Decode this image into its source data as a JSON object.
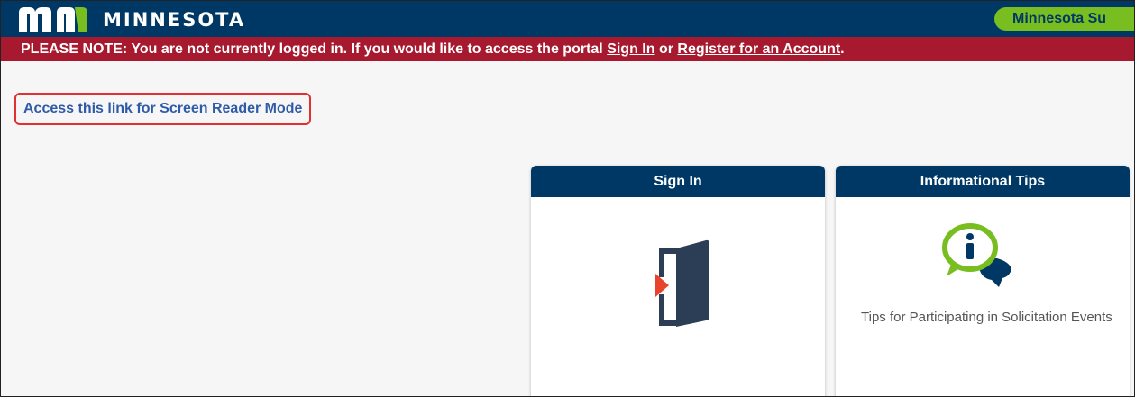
{
  "header": {
    "logo_text": "MINNESOTA",
    "pill_text": "Minnesota Su"
  },
  "notice": {
    "prefix": "PLEASE NOTE:  You are not currently logged in.  If you would like to access the portal ",
    "sign_in": "Sign In",
    "or_text": " or ",
    "register": "Register for an Account",
    "suffix": "."
  },
  "screen_reader_link": "Access this link for Screen Reader Mode",
  "tiles": [
    {
      "title": "Sign In",
      "icon": "door-enter-icon",
      "description": ""
    },
    {
      "title": "Informational Tips",
      "icon": "info-speech-bubble-icon",
      "description": "Tips for Participating in Solicitation Events"
    }
  ],
  "colors": {
    "header_bg": "#003865",
    "notice_bg": "#a6192e",
    "pill_bg": "#78be21",
    "link": "#2f5aa8",
    "highlight": "#e03030",
    "arrow": "#e8442c"
  }
}
